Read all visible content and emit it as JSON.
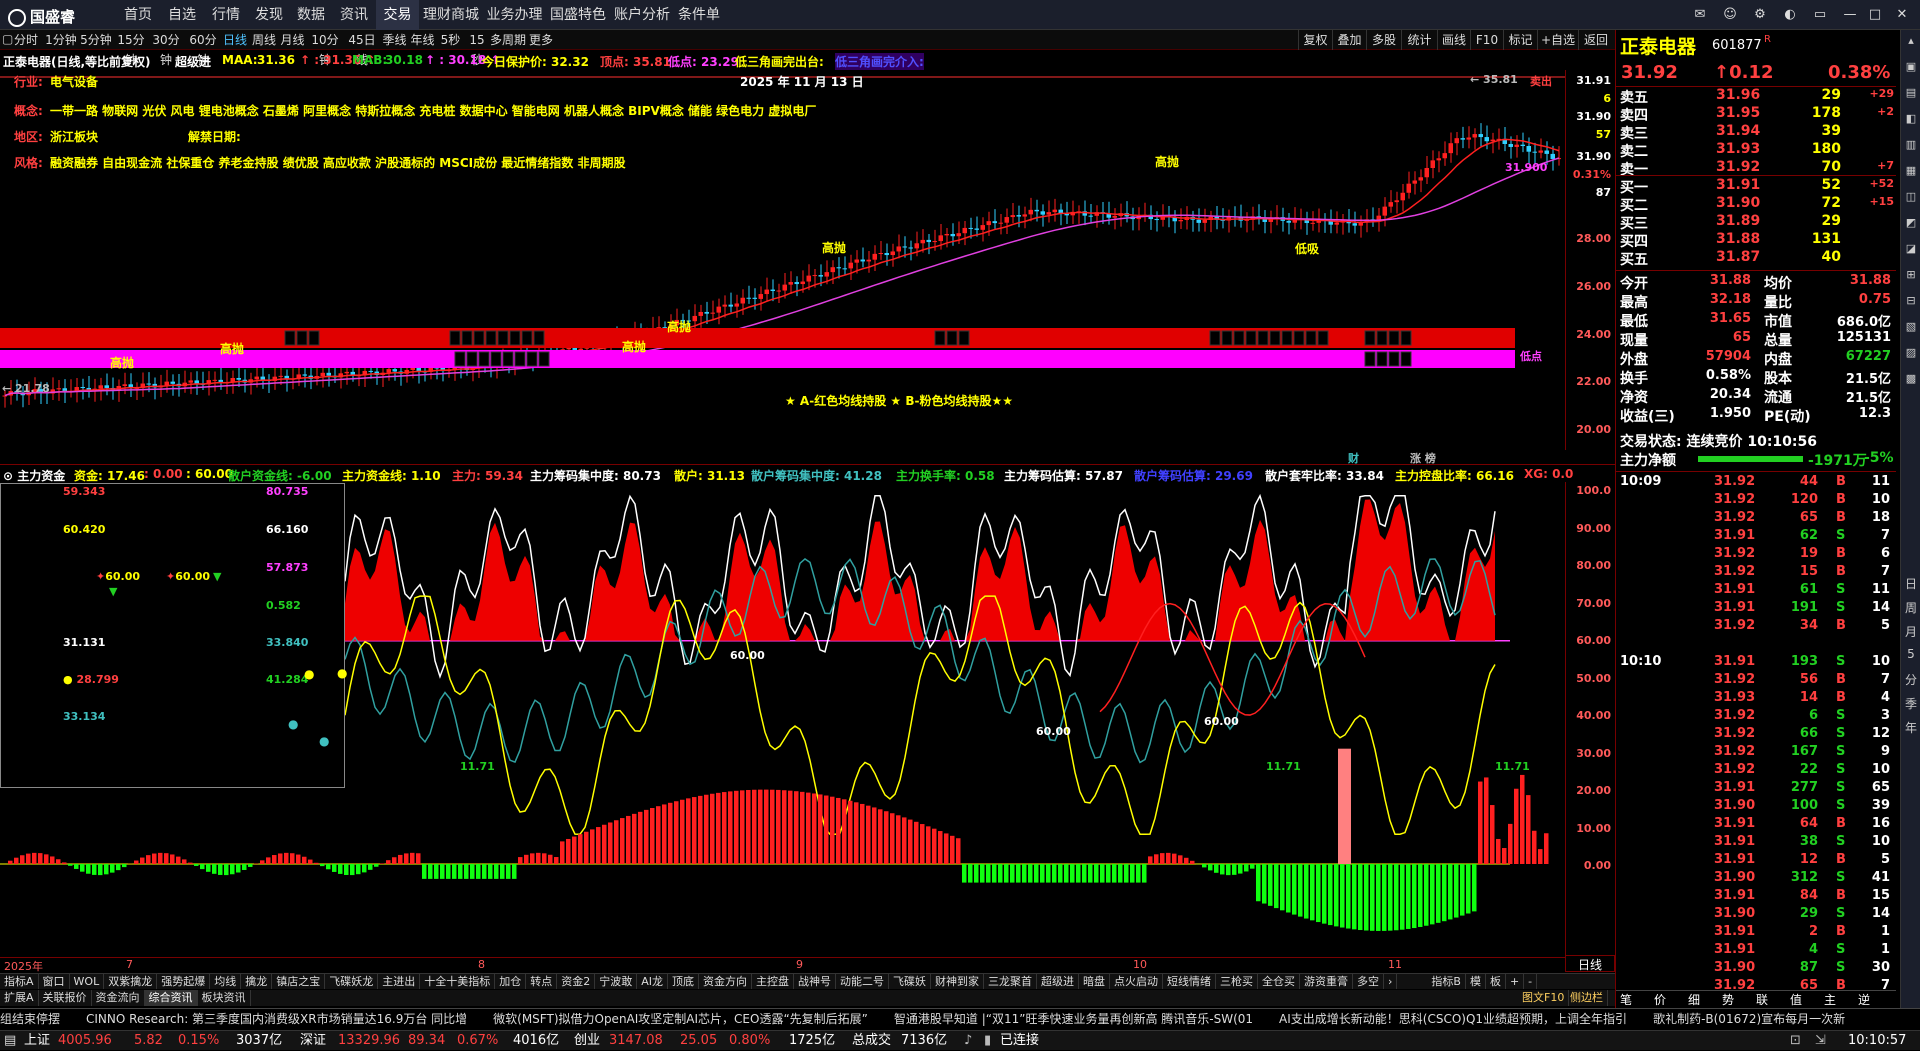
{
  "app": {
    "name": "国盛睿",
    "nav": [
      "首页",
      "自选",
      "行情",
      "发现",
      "数据",
      "资讯",
      "交易",
      "理财商城",
      "业务办理",
      "国盛特色",
      "账户分析",
      "条件单"
    ],
    "active_nav": "交易"
  },
  "periods": {
    "items": [
      "分时",
      "1分钟",
      "5分钟",
      "15分钟",
      "30分钟",
      "60分钟",
      "日线",
      "周线",
      "月线",
      "10分钟",
      "45日线",
      "季线",
      "年线",
      "5秒",
      "15秒",
      "多周期",
      "更多"
    ],
    "active": "日线"
  },
  "tools": [
    "复权",
    "叠加",
    "多股",
    "统计",
    "画线",
    "F10",
    "标记",
    "+自选",
    "返回"
  ],
  "kline_legend": {
    "title": "正泰电器(日线,等比前复权)",
    "indicator": "超级进",
    "maa_label": "MAA:",
    "maa_val": "31.36",
    "maa_val2": "31.36",
    "mab_label": "MAB:",
    "mab_val": "30.18",
    "mab_val2": "30.18",
    "keep_price": "今日保护价: 32.32",
    "top_pt": "顶点: 35.81",
    "bottom_pt": "低点: 23.29",
    "tri1": "低三角画完出台:",
    "tri2": "低三角画完介入:"
  },
  "stock_info": {
    "industry_label": "行业:",
    "industry": "电气设备",
    "concept_label": "概念:",
    "concept": "一带一路 物联网 光伏 风电 锂电池概念 石墨烯 阿里概念 特斯拉概念 充电桩 数据中心 智能电网 机器人概念 BIPV概念 储能 绿色电力 虚拟电厂",
    "region_label": "地区:",
    "region": "浙江板块",
    "unban_label": "解禁日期:",
    "style_label": "风格:",
    "style": "融资融券 自由现金流 社保重仓 养老金持股 绩优股 高应收款 沪股通标的 MSCI成份 最近情绪指数 非周期股",
    "date": "2025 年 11 月 13 日"
  },
  "kline_labels": {
    "high": "35.81",
    "start": "21.78",
    "current": "31.900",
    "low_pt": "低点",
    "sell": "卖出",
    "gaopao": "高抛",
    "dixi": "低吸",
    "band_text": "★ A-红色均线持股 ★ B-粉色均线持股★★",
    "cai": "财",
    "zhang": "涨 榜"
  },
  "kline_axis": [
    "31.91",
    "6",
    "31.90",
    "57",
    "31.90",
    "0.31%",
    "87",
    "28.00",
    "26.00",
    "24.00",
    "22.00",
    "20.00"
  ],
  "indicator_legend": {
    "zhuli": "主力资金",
    "zj": "资金: 17.46",
    "zj2": ": 0.00",
    "zj3": ": 60.00",
    "sanhu": "散户资金线: -6.00",
    "zljx": "主力资金线: 1.10",
    "zl": "主力: 59.34",
    "zlcm": "主力筹码集中度: 80.73",
    "sh": "散户: 31.13",
    "shcm": "散户筹码集中度: 41.28",
    "zlhs": "主力换手率: 0.58",
    "zlgj": "主力筹码估算: 57.87",
    "shgj": "散户筹码估算: 29.69",
    "shtl": "散户套牢比率: 33.84",
    "zlkp": "主力控盘比率: 66.16",
    "xg": "XG: 0.0"
  },
  "indicator_axis": [
    "100.0",
    "90.00",
    "80.00",
    "70.00",
    "60.00",
    "50.00",
    "40.00",
    "30.00",
    "20.00",
    "10.00",
    "0.00"
  ],
  "indicator_labels": {
    "l60a": "60.00",
    "l60b": "60.00",
    "l60c": "60.00",
    "l1171a": "11.71",
    "l1171b": "11.71",
    "l1171c": "11.71"
  },
  "popup": {
    "v1": "59.343",
    "v2": "80.735",
    "v3": "60.420",
    "v4": "66.160",
    "v5": "60.00",
    "v6": "60.00",
    "v7": "57.873",
    "v8": "0.582",
    "v9": "31.131",
    "v10": "33.840",
    "v11": "28.799",
    "v12": "41.284",
    "v13": "33.134"
  },
  "date_axis": [
    "2025年",
    "7",
    "8",
    "9",
    "10",
    "11"
  ],
  "day_label": "日线",
  "tabs": [
    "指标A",
    "窗口",
    "WOL",
    "双紫擒龙",
    "强势起爆",
    "均线",
    "擒龙",
    "镇店之宝",
    "飞碟妖龙",
    "主进出",
    "十全十美指标",
    "加仓",
    "转点",
    "资金2",
    "宁波敢",
    "AI龙",
    "顶底",
    "资金方向",
    "主控盘",
    "战神号",
    "动能二号",
    "飞碟妖",
    "财神到家",
    "三龙聚首",
    "超级进",
    "暗盘",
    "点火启动",
    "短线情绪",
    "三枪买",
    "全仓买",
    "游资重膏",
    "多空"
  ],
  "tabs_right": [
    "指标B",
    "模",
    "板",
    "+",
    "-"
  ],
  "subtabs": [
    "扩展A",
    "关联报价",
    "资金流向",
    "综合资讯",
    "板块资讯"
  ],
  "subtabs_active": "综合资讯",
  "subtabs_right": [
    "图文F10",
    "侧边栏"
  ],
  "ticker": [
    "组结束停摆",
    "CINNO Research: 第三季度国内消费级XR市场销量达16.9万台 同比增",
    "微软(MSFT)拟借力OpenAI攻坚定制AI芯片，CEO透露“先复制后拓展”",
    "智通港股早知道 |“双11”旺季快速业务量再创新高 腾讯音乐-SW(01",
    "AI支出成增长新动能！思科(CSCO)Q1业绩超预期，上调全年指引",
    "歌礼制药-B(01672)宣布每月一次新"
  ],
  "status": {
    "sh_label": "上证",
    "sh_val": "4005.96",
    "sh_chg": "5.82",
    "sh_pct": "0.15%",
    "sh_amt": "3037亿",
    "sz_label": "深证",
    "sz_val": "13329.96",
    "sz_chg": "89.34",
    "sz_pct": "0.67%",
    "sz_amt": "4016亿",
    "cy_label": "创业",
    "cy_val": "3147.08",
    "cy_chg": "25.05",
    "cy_pct": "0.80%",
    "cy_amt": "1725亿",
    "total_label": "总成交",
    "total": "7136亿",
    "conn": "已连接",
    "time": "10:10:57"
  },
  "quote": {
    "name": "正泰电器",
    "code": "601877",
    "tag": "R",
    "price": "31.92",
    "chg": "0.12",
    "pct": "0.38%",
    "asks": [
      {
        "label": "卖五",
        "p": "31.96",
        "v": "29",
        "d": "+29"
      },
      {
        "label": "卖四",
        "p": "31.95",
        "v": "178",
        "d": "+2"
      },
      {
        "label": "卖三",
        "p": "31.94",
        "v": "39",
        "d": ""
      },
      {
        "label": "卖二",
        "p": "31.93",
        "v": "180",
        "d": ""
      },
      {
        "label": "卖一",
        "p": "31.92",
        "v": "70",
        "d": "+7"
      }
    ],
    "bids": [
      {
        "label": "买一",
        "p": "31.91",
        "v": "52",
        "d": "+52"
      },
      {
        "label": "买二",
        "p": "31.90",
        "v": "72",
        "d": "+15"
      },
      {
        "label": "买三",
        "p": "31.89",
        "v": "29",
        "d": ""
      },
      {
        "label": "买四",
        "p": "31.88",
        "v": "131",
        "d": ""
      },
      {
        "label": "买五",
        "p": "31.87",
        "v": "40",
        "d": ""
      }
    ],
    "stats": [
      [
        "今开",
        "31.88",
        "均价",
        "31.88"
      ],
      [
        "最高",
        "32.18",
        "量比",
        "0.75"
      ],
      [
        "最低",
        "31.65",
        "市值",
        "686.0亿"
      ],
      [
        "现量",
        "65",
        "总量",
        "125131"
      ],
      [
        "外盘",
        "57904",
        "内盘",
        "67227"
      ],
      [
        "换手",
        "0.58%",
        "股本",
        "21.5亿"
      ],
      [
        "净资",
        "20.34",
        "流通",
        "21.5亿"
      ],
      [
        "收益(三)",
        "1.950",
        "PE(动)",
        "12.3"
      ]
    ],
    "trade_state": "交易状态: 连续竞价 10:10:56",
    "net_label": "主力净额",
    "net_val": "-1971万",
    "net_pct": "-5%"
  },
  "ticks": [
    [
      "10:09",
      "31.92",
      "44",
      "B",
      "11"
    ],
    [
      "",
      "31.92",
      "120",
      "B",
      "10"
    ],
    [
      "",
      "31.92",
      "65",
      "B",
      "18"
    ],
    [
      "",
      "31.91",
      "62",
      "S",
      "7"
    ],
    [
      "",
      "31.92",
      "19",
      "B",
      "6"
    ],
    [
      "",
      "31.92",
      "15",
      "B",
      "7"
    ],
    [
      "",
      "31.91",
      "61",
      "S",
      "11"
    ],
    [
      "",
      "31.91",
      "191",
      "S",
      "14"
    ],
    [
      "",
      "31.92",
      "34",
      "B",
      "5"
    ],
    [
      "10:10",
      "31.91",
      "193",
      "S",
      "10"
    ],
    [
      "",
      "31.92",
      "56",
      "B",
      "7"
    ],
    [
      "",
      "31.93",
      "14",
      "B",
      "4"
    ],
    [
      "",
      "31.92",
      "6",
      "S",
      "3"
    ],
    [
      "",
      "31.92",
      "66",
      "S",
      "12"
    ],
    [
      "",
      "31.92",
      "167",
      "S",
      "9"
    ],
    [
      "",
      "31.92",
      "22",
      "S",
      "10"
    ],
    [
      "",
      "31.91",
      "277",
      "S",
      "65"
    ],
    [
      "",
      "31.90",
      "100",
      "S",
      "39"
    ],
    [
      "",
      "31.91",
      "64",
      "B",
      "16"
    ],
    [
      "",
      "31.91",
      "38",
      "S",
      "10"
    ],
    [
      "",
      "31.91",
      "12",
      "B",
      "5"
    ],
    [
      "",
      "31.90",
      "312",
      "S",
      "41"
    ],
    [
      "",
      "31.91",
      "84",
      "B",
      "15"
    ],
    [
      "",
      "31.90",
      "29",
      "S",
      "14"
    ],
    [
      "",
      "31.91",
      "2",
      "B",
      "1"
    ],
    [
      "",
      "31.91",
      "4",
      "S",
      "1"
    ],
    [
      "",
      "31.90",
      "87",
      "S",
      "30"
    ],
    [
      "",
      "31.92",
      "65",
      "B",
      "7"
    ]
  ],
  "bottom_tabs": [
    "笔",
    "价",
    "细",
    "势",
    "联",
    "值",
    "主",
    "逆"
  ],
  "sidebar": [
    "日",
    "周",
    "月",
    "5",
    "分",
    "季",
    "年"
  ],
  "colors": {
    "up": "#ff3030",
    "down": "#00ff40",
    "bg": "#000000",
    "accent": "#ff00ff"
  }
}
